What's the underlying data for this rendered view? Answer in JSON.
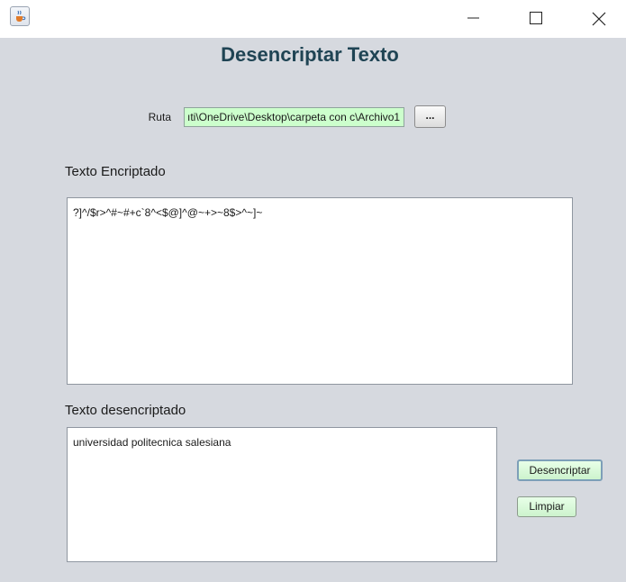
{
  "window": {
    "icon": "java-cup-icon",
    "controls": [
      "minimize-icon",
      "maximize-icon",
      "close-icon"
    ]
  },
  "heading": "Desencriptar Texto",
  "ruta": {
    "label": "Ruta",
    "value": "ıti\\OneDrive\\Desktop\\carpeta con c\\Archivo1",
    "field_color": "#ccffcc",
    "browse_label": "..."
  },
  "encrypted": {
    "label": "Texto Encriptado",
    "text": "?]^/$r>^#~#+c`8^<$@]^@~+>~8$>^~]~"
  },
  "decrypted": {
    "label": "Texto desencriptado",
    "text": "universidad politecnica salesiana"
  },
  "buttons": {
    "decrypt_label": "Desencriptar",
    "clear_label": "Limpiar",
    "button_color": "#ccffcc"
  },
  "colors": {
    "heading": "#1f4454",
    "background": "#d6d9df"
  }
}
